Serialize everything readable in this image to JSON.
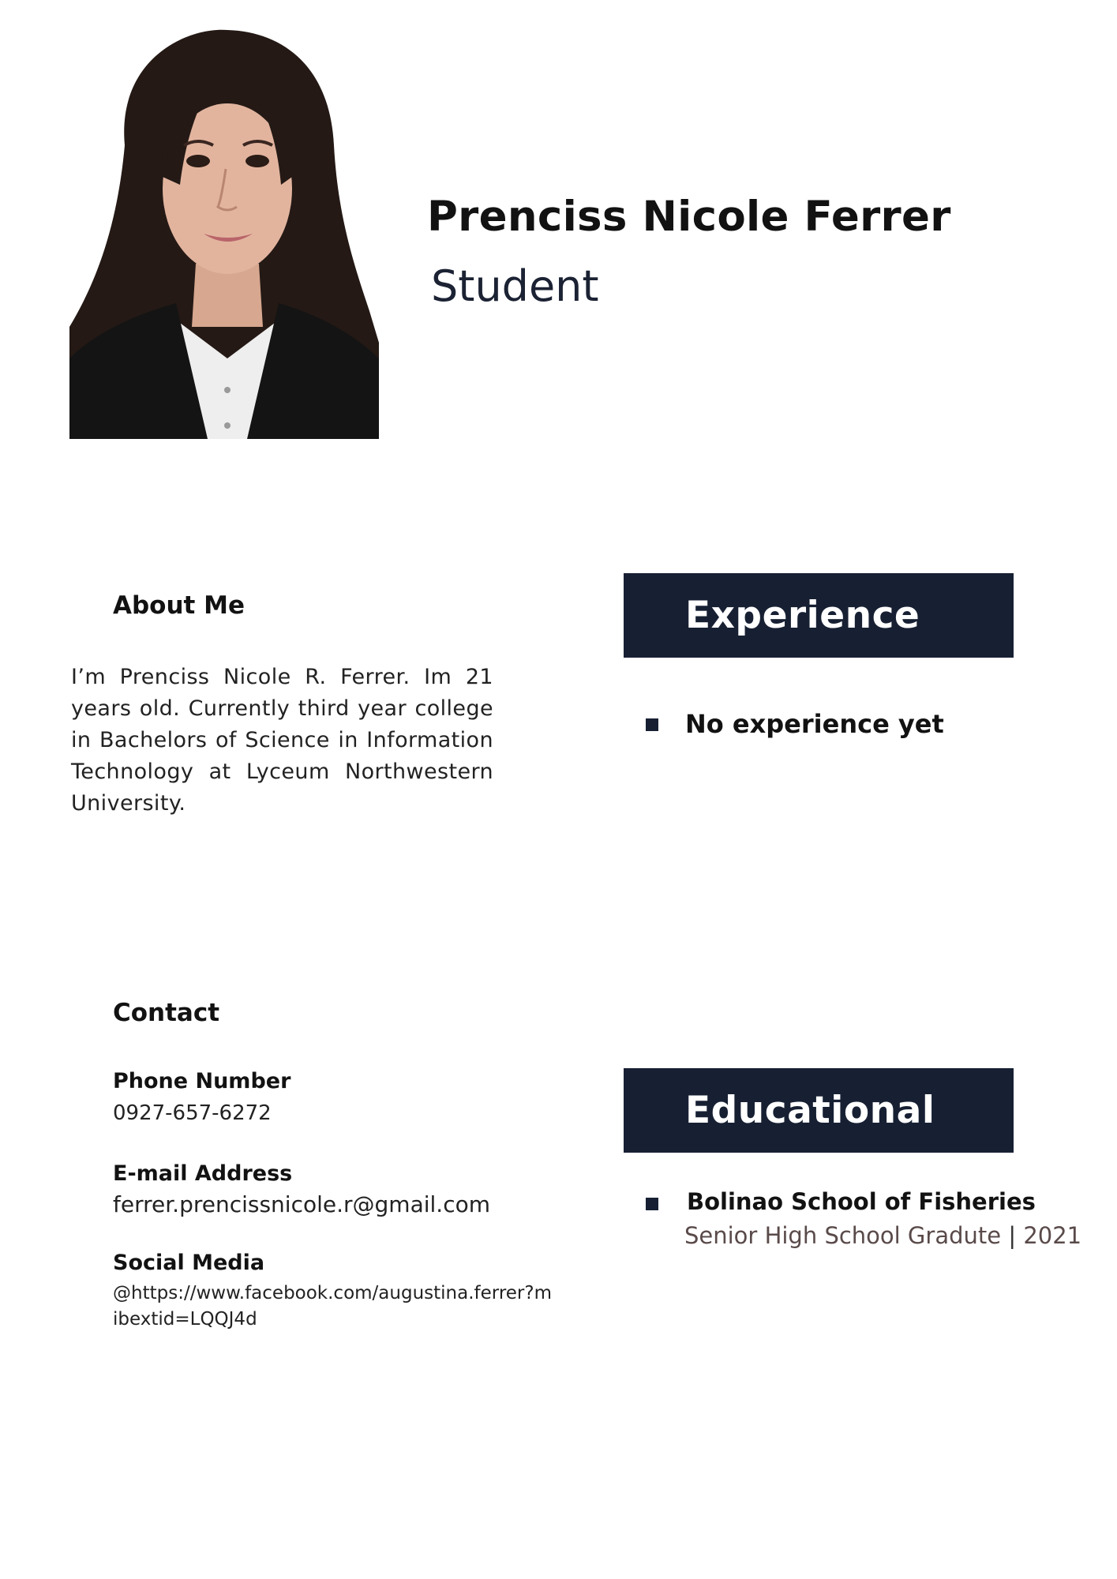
{
  "header": {
    "name": "Prenciss Nicole Ferrer",
    "role": "Student"
  },
  "photo": {
    "icon": "profile-photo"
  },
  "about": {
    "title": "About Me",
    "text": "I’m Prenciss Nicole R. Ferrer. Im 21 years old. Currently third year college in Bachelors of Science in Information Technology at Lyceum Northwestern University."
  },
  "contact": {
    "title": "Contact",
    "phone_label": "Phone Number",
    "phone": "0927-657-6272",
    "email_label": "E-mail Address",
    "email": "ferrer.prencissnicole.r@gmail.com",
    "social_label": "Social Media",
    "social": "@https://www.facebook.com/augustina.ferrer?mibextid=LQQJ4d"
  },
  "experience": {
    "title": "Experience",
    "items": [
      "No experience yet"
    ]
  },
  "education": {
    "title": "Educational",
    "school": "Bolinao School of Fisheries",
    "detail": "Senior High School Gradute",
    "separator": "|",
    "year": "2021"
  },
  "colors": {
    "banner": "#172033",
    "text": "#121212",
    "muted": "#5a4a4a"
  }
}
